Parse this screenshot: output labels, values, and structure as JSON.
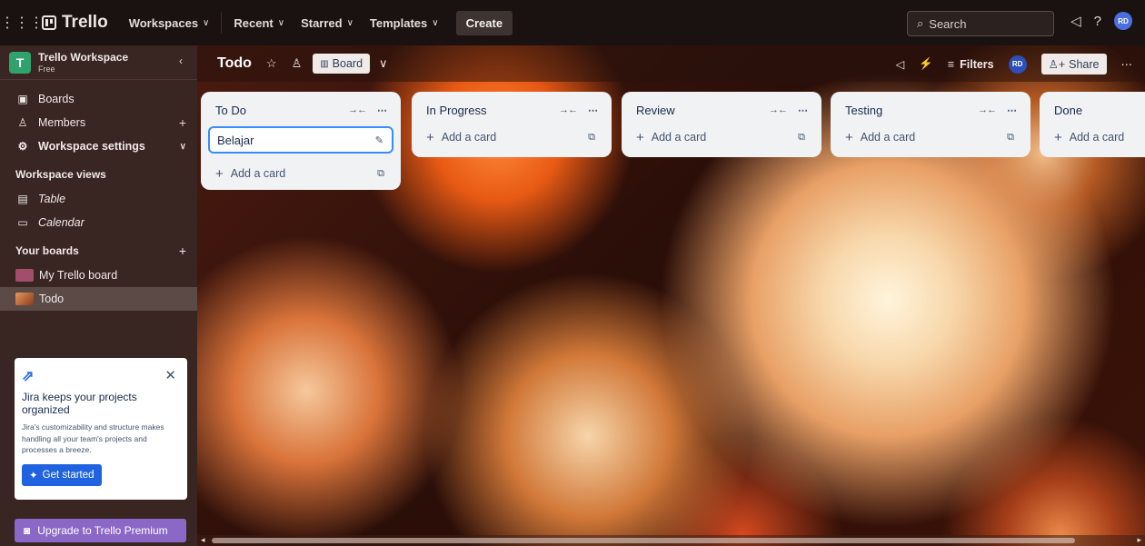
{
  "topbar": {
    "brand": "Trello",
    "nav": [
      "Workspaces",
      "Recent",
      "Starred",
      "Templates"
    ],
    "create_label": "Create",
    "search_placeholder": "Search",
    "avatar_initials": "RD"
  },
  "sidebar": {
    "workspace_initial": "T",
    "workspace_name": "Trello Workspace",
    "workspace_plan": "Free",
    "items": [
      {
        "label": "Boards",
        "icon": "boards-icon"
      },
      {
        "label": "Members",
        "icon": "members-icon"
      },
      {
        "label": "Workspace settings",
        "icon": "settings-icon"
      }
    ],
    "views_heading": "Workspace views",
    "views": [
      {
        "label": "Table",
        "icon": "table-icon"
      },
      {
        "label": "Calendar",
        "icon": "calendar-icon"
      }
    ],
    "boards_heading": "Your boards",
    "boards": [
      {
        "label": "My Trello board",
        "swatch": "#a24d6b"
      },
      {
        "label": "Todo",
        "swatch": "#c0653a"
      }
    ],
    "promo": {
      "title": "Jira keeps your projects organized",
      "description": "Jira's customizability and structure makes handling all your team's projects and processes a breeze.",
      "cta": "Get started"
    },
    "upgrade_label": "Upgrade to Trello Premium"
  },
  "board": {
    "title": "Todo",
    "view_label": "Board",
    "filters_label": "Filters",
    "share_label": "Share",
    "member_initials": "RD"
  },
  "lists": [
    {
      "title": "To Do",
      "cards": [
        "Belajar"
      ],
      "add_label": "Add a card"
    },
    {
      "title": "In Progress",
      "cards": [],
      "add_label": "Add a card"
    },
    {
      "title": "Review",
      "cards": [],
      "add_label": "Add a card"
    },
    {
      "title": "Testing",
      "cards": [],
      "add_label": "Add a card"
    },
    {
      "title": "Done",
      "cards": [],
      "add_label": "Add a card"
    }
  ],
  "colors": {
    "accent": "#388bff",
    "workspace_badge": "#2fa36b",
    "upgrade": "#8b68c7",
    "primary_button": "#1f63e0"
  }
}
